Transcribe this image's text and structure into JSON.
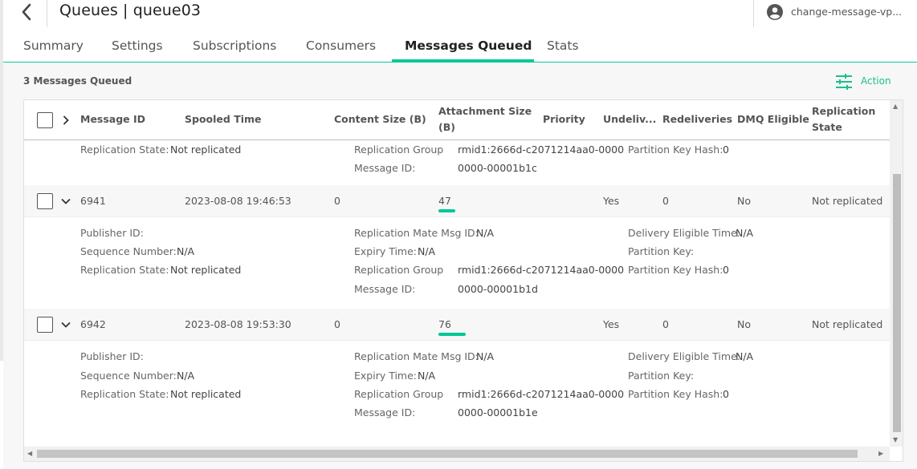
{
  "header": {
    "title": "Queues | queue03",
    "user": "change-message-vp..."
  },
  "tabs": [
    {
      "label": "Summary",
      "active": false
    },
    {
      "label": "Settings",
      "active": false
    },
    {
      "label": "Subscriptions",
      "active": false
    },
    {
      "label": "Consumers",
      "active": false
    },
    {
      "label": "Messages Queued",
      "active": true
    },
    {
      "label": "Stats",
      "active": false
    }
  ],
  "content": {
    "count_label": "3 Messages Queued",
    "action_label": "Action"
  },
  "columns": {
    "message_id": "Message ID",
    "spooled_time": "Spooled Time",
    "content_size": "Content Size (B)",
    "attachment_size_1": "Attachment Size",
    "attachment_size_2": "(B)",
    "priority": "Priority",
    "undelivered": "Undeliv...",
    "redeliveries": "Redeliveries",
    "dmq_eligible": "DMQ Eligible",
    "replication_state_1": "Replication",
    "replication_state_2": "State"
  },
  "detail_labels": {
    "publisher_id": "Publisher ID:",
    "sequence_number": "Sequence Number:",
    "replication_state": "Replication State:",
    "replication_mate": "Replication Mate Msg ID:",
    "expiry_time": "Expiry Time:",
    "replication_group": "Replication Group",
    "message_id": "Message ID:",
    "delivery_eligible": "Delivery Eligible Time:",
    "partition_key": "Partition Key:",
    "partition_key_hash": "Partition Key Hash:"
  },
  "partial_detail": {
    "replication_state": "Not replicated",
    "replication_group": "rmid1:2666d-c2071214aa0-0000",
    "message_id": "0000-00001b1c",
    "partition_key_hash": "0"
  },
  "messages": [
    {
      "id": "6941",
      "spooled_time": "2023-08-08 19:46:53",
      "content_size": "0",
      "attachment_size": "47",
      "attachment_bar_fraction": 0.62,
      "undelivered": "Yes",
      "redeliveries": "0",
      "dmq_eligible": "No",
      "replication_state": "Not replicated",
      "detail": {
        "sequence_number": "N/A",
        "replication_state": "Not replicated",
        "replication_mate": "N/A",
        "expiry_time": "N/A",
        "replication_group": "rmid1:2666d-c2071214aa0-0000",
        "message_id": "0000-00001b1d",
        "delivery_eligible": "N/A",
        "partition_key_hash": "0"
      }
    },
    {
      "id": "6942",
      "spooled_time": "2023-08-08 19:53:30",
      "content_size": "0",
      "attachment_size": "76",
      "attachment_bar_fraction": 1.0,
      "undelivered": "Yes",
      "redeliveries": "0",
      "dmq_eligible": "No",
      "replication_state": "Not replicated",
      "detail": {
        "sequence_number": "N/A",
        "replication_state": "Not replicated",
        "replication_mate": "N/A",
        "expiry_time": "N/A",
        "replication_group": "rmid1:2666d-c2071214aa0-0000",
        "message_id": "0000-00001b1e",
        "delivery_eligible": "N/A",
        "partition_key_hash": "0"
      }
    }
  ],
  "colors": {
    "accent": "#00c895",
    "action": "#1cbf8e"
  },
  "icons": {
    "back": "chevron-left-icon",
    "user": "account-circle-icon",
    "action": "tune-sliders-icon"
  }
}
